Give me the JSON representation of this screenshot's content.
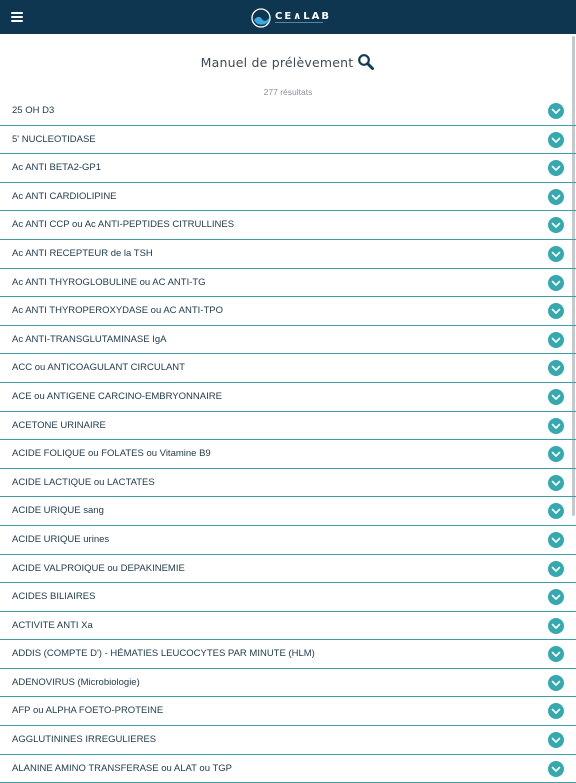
{
  "header": {
    "brand": "CE∧LAB",
    "menu_icon": "hamburger-menu-icon",
    "logo_icon": "wave-circle-logo",
    "background": "#0f3650"
  },
  "page": {
    "title": "Manuel de prélèvement",
    "search_icon": "search-icon",
    "result_count": "277 résultats"
  },
  "colors": {
    "accent": "#35a9ae",
    "divider": "#3e9ea1",
    "text": "#1f3a4d"
  },
  "items": [
    {
      "label": "25 OH D3"
    },
    {
      "label": "5' NUCLEOTIDASE"
    },
    {
      "label": "Ac ANTI BETA2-GP1"
    },
    {
      "label": "Ac ANTI CARDIOLIPINE"
    },
    {
      "label": "Ac ANTI CCP ou Ac ANTI-PEPTIDES CITRULLINES"
    },
    {
      "label": "Ac ANTI RECEPTEUR de la TSH"
    },
    {
      "label": "Ac ANTI THYROGLOBULINE ou AC ANTI-TG"
    },
    {
      "label": "Ac ANTI THYROPEROXYDASE ou AC ANTI-TPO"
    },
    {
      "label": "Ac ANTI-TRANSGLUTAMINASE IgA"
    },
    {
      "label": "ACC ou ANTICOAGULANT CIRCULANT"
    },
    {
      "label": "ACE ou ANTIGENE CARCINO-EMBRYONNAIRE"
    },
    {
      "label": "ACETONE URINAIRE"
    },
    {
      "label": "ACIDE FOLIQUE ou FOLATES ou Vitamine B9"
    },
    {
      "label": "ACIDE LACTIQUE ou LACTATES"
    },
    {
      "label": "ACIDE URIQUE sang"
    },
    {
      "label": "ACIDE URIQUE urines"
    },
    {
      "label": "ACIDE VALPROIQUE ou DEPAKINEMIE"
    },
    {
      "label": "ACIDES BILIAIRES"
    },
    {
      "label": "ACTIVITE ANTI Xa"
    },
    {
      "label": "ADDIS (COMPTE D') - HÉMATIES LEUCOCYTES PAR MINUTE (HLM)"
    },
    {
      "label": "ADENOVIRUS (Microbiologie)"
    },
    {
      "label": "AFP ou ALPHA FOETO-PROTEINE"
    },
    {
      "label": "AGGLUTININES IRREGULIERES"
    },
    {
      "label": "ALANINE AMINO TRANSFERASE ou ALAT ou TGP"
    }
  ]
}
